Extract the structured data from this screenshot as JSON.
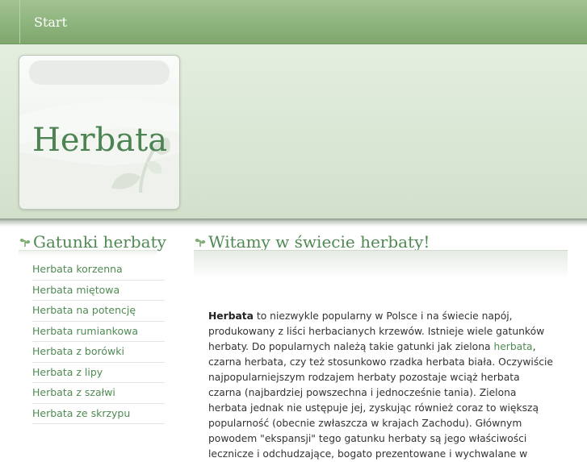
{
  "nav": {
    "start_label": "Start"
  },
  "header": {
    "logo_title": "Herbata"
  },
  "sidebar": {
    "title": "Gatunki herbaty",
    "items": [
      "Herbata korzenna",
      "Herbata miętowa",
      "Herbata na potencję",
      "Herbata rumiankowa",
      "Herbata z borówki",
      "Herbata z lipy",
      "Herbata z szałwi",
      "Herbata ze skrzypu"
    ]
  },
  "main": {
    "title": "Witamy w świecie herbaty!",
    "p_bold": "Herbata",
    "p_part1": " to niezwykle popularny w Polsce i na świecie napój, produkowany z liści herbacianych krzewów. Istnieje wiele gatunków herbaty. Do popularnych należą takie gatunki jak zielona ",
    "p_link": "herbata",
    "p_part2": ", czarna herbata, czy też stosunkowo rzadka herbata biała. Oczywiście najpopularniejszym rodzajem herbaty pozostaje wciąż herbata czarna (najbardziej powszechna i jednocześnie tania). Zielona herbata jednak nie ustępuje jej, zyskując również coraz to większą popularność (obecnie zwłaszcza w krajach Zachodu). Głównym powodem \"ekspansji\" tego gatunku herbaty są jego właściwości lecznicze i odchudzające, bogato prezentowane i wychwalane w"
  },
  "colors": {
    "accent_green": "#4f8a53",
    "nav_bar": "#8fb57e",
    "header_bg": "#d9e6d3"
  },
  "icons": [
    "leaf-icon"
  ]
}
